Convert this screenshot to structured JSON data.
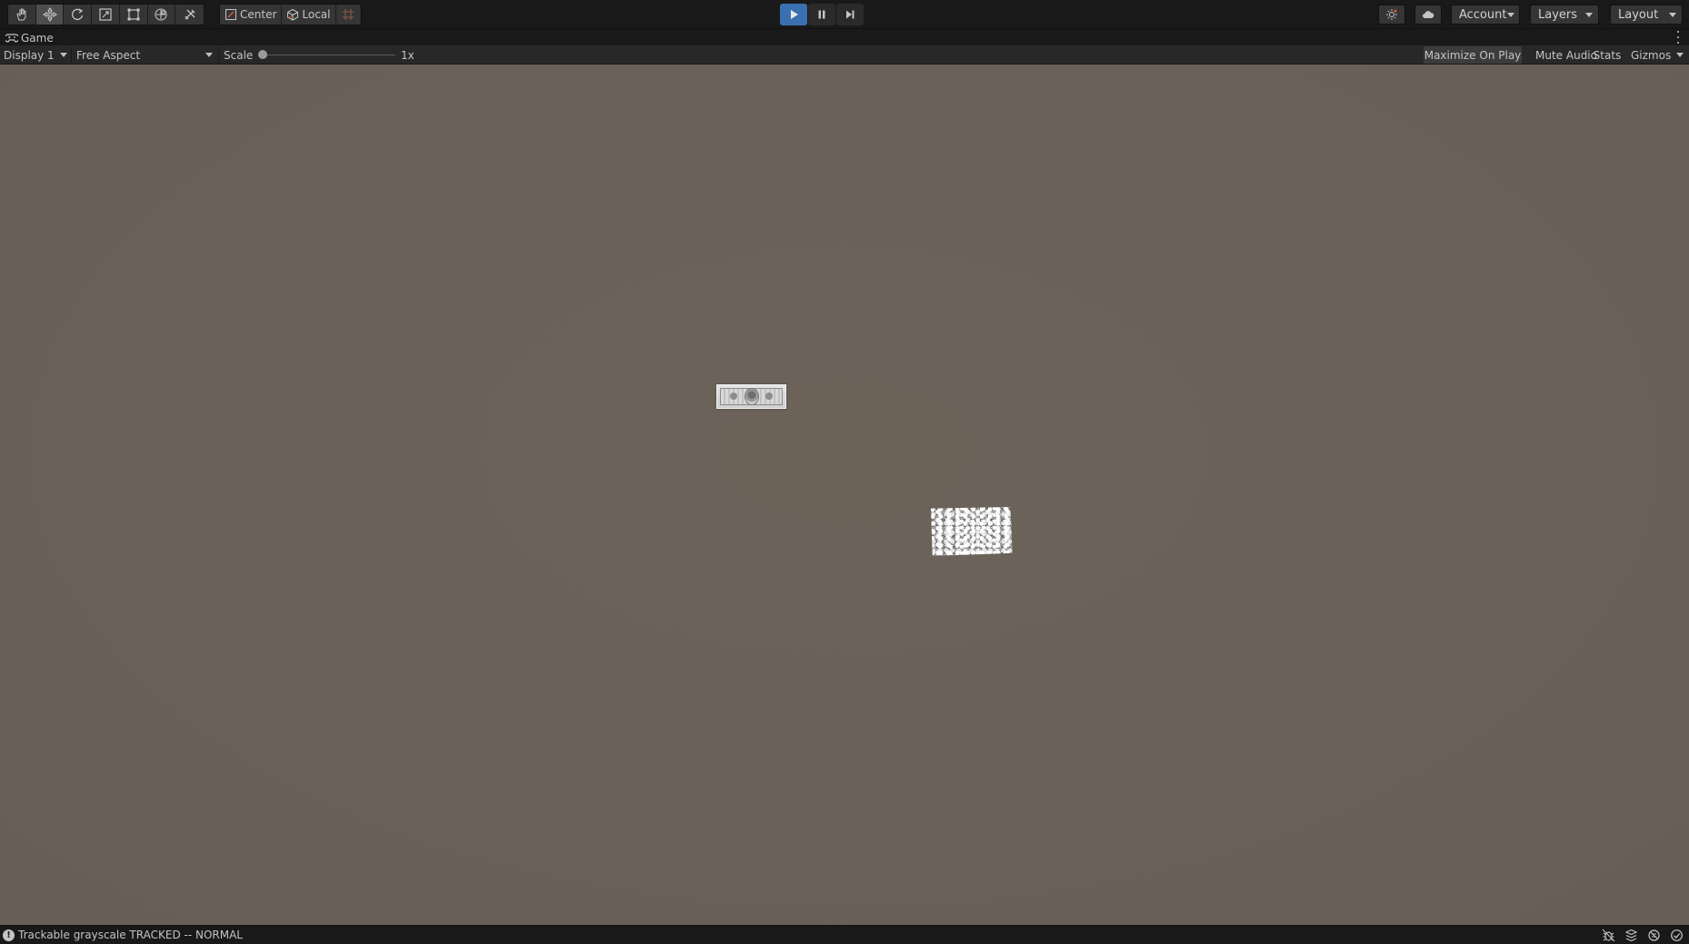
{
  "toolbar": {
    "tools": [
      "hand-tool-icon",
      "move-tool-icon",
      "rotate-tool-icon",
      "scale-tool-icon",
      "rect-tool-icon",
      "transform-tool-icon",
      "custom-editor-tool-icon"
    ],
    "active_tool": "move-tool-icon",
    "pivot_mode_label": "Center",
    "pivot_rotation_label": "Local",
    "grid_snap_icon": "grid-snap-icon",
    "play_state": "playing",
    "account_label": "Account",
    "layers_label": "Layers",
    "layout_label": "Layout",
    "play_accent_color": "#3a70b0"
  },
  "game_tab": {
    "title": "Game",
    "icon": "gamepad-icon"
  },
  "game_bar": {
    "display_label": "Display 1",
    "aspect_label": "Free Aspect",
    "scale_label": "Scale",
    "scale_value": "1x",
    "maximize_label": "Maximize On Play",
    "mute_label": "Mute Audio",
    "stats_label": "Stats",
    "gizmos_label": "Gizmos"
  },
  "viewport": {
    "background_color": "#6a6159",
    "objects": [
      "banknote-target",
      "gravel-target"
    ]
  },
  "status": {
    "message": "Trackable grayscale TRACKED -- NORMAL"
  }
}
